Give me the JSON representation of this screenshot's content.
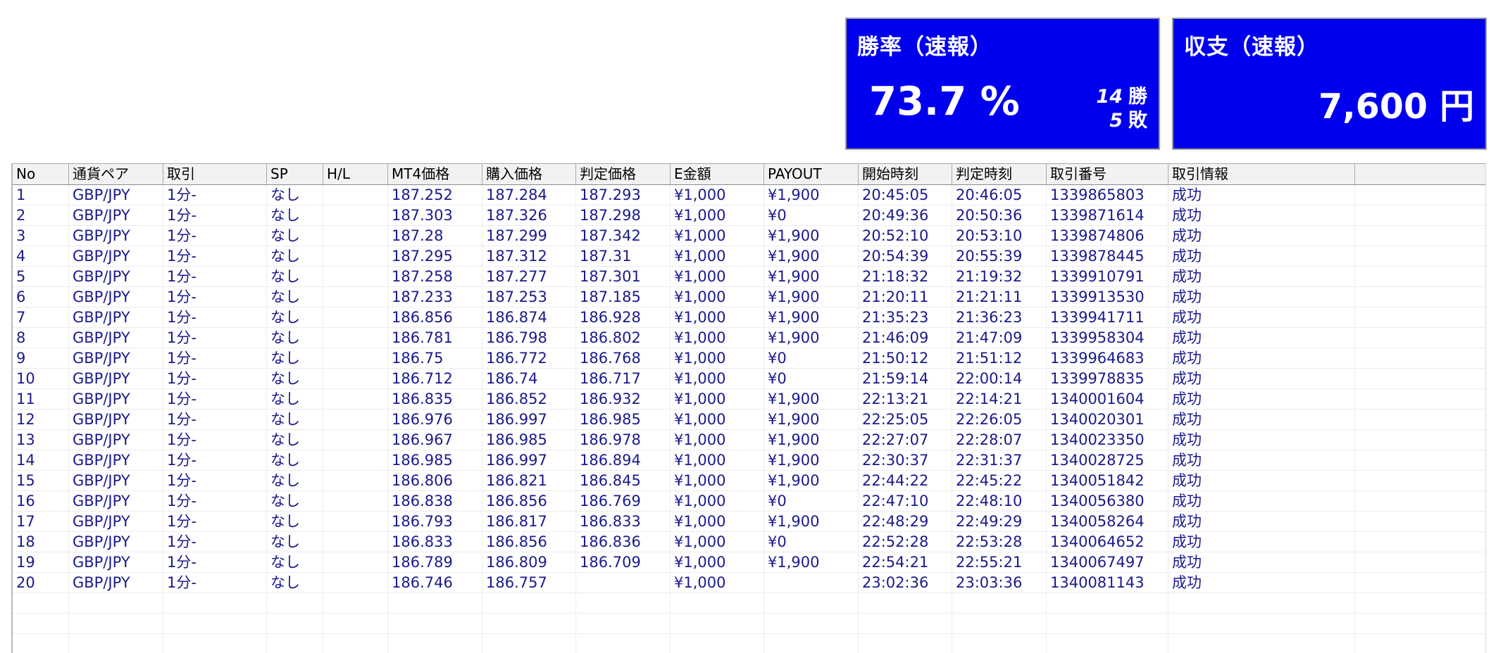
{
  "winrate_panel": {
    "title": "勝率（速報）",
    "value": "73.7 %",
    "wins": "14",
    "wins_unit": "勝",
    "losses": "5",
    "losses_unit": "敗"
  },
  "balance_panel": {
    "title": "収支（速報）",
    "value": "7,600 円"
  },
  "colors": {
    "panel_bg": "#0000ee",
    "panel_text": "#ffffff",
    "table_text": "#1a1a8c"
  },
  "table": {
    "columns": [
      "No",
      "通貨ペア",
      "取引",
      "SP",
      "H/L",
      "MT4価格",
      "購入価格",
      "判定価格",
      "E金額",
      "PAYOUT",
      "開始時刻",
      "判定時刻",
      "取引番号",
      "取引情報",
      ""
    ],
    "rows": [
      [
        "1",
        "GBP/JPY",
        "1分-",
        "なし",
        "",
        "187.252",
        "187.284",
        "187.293",
        "¥1,000",
        "¥1,900",
        "20:45:05",
        "20:46:05",
        "1339865803",
        "成功",
        ""
      ],
      [
        "2",
        "GBP/JPY",
        "1分-",
        "なし",
        "",
        "187.303",
        "187.326",
        "187.298",
        "¥1,000",
        "¥0",
        "20:49:36",
        "20:50:36",
        "1339871614",
        "成功",
        ""
      ],
      [
        "3",
        "GBP/JPY",
        "1分-",
        "なし",
        "",
        "187.28",
        "187.299",
        "187.342",
        "¥1,000",
        "¥1,900",
        "20:52:10",
        "20:53:10",
        "1339874806",
        "成功",
        ""
      ],
      [
        "4",
        "GBP/JPY",
        "1分-",
        "なし",
        "",
        "187.295",
        "187.312",
        "187.31",
        "¥1,000",
        "¥1,900",
        "20:54:39",
        "20:55:39",
        "1339878445",
        "成功",
        ""
      ],
      [
        "5",
        "GBP/JPY",
        "1分-",
        "なし",
        "",
        "187.258",
        "187.277",
        "187.301",
        "¥1,000",
        "¥1,900",
        "21:18:32",
        "21:19:32",
        "1339910791",
        "成功",
        ""
      ],
      [
        "6",
        "GBP/JPY",
        "1分-",
        "なし",
        "",
        "187.233",
        "187.253",
        "187.185",
        "¥1,000",
        "¥1,900",
        "21:20:11",
        "21:21:11",
        "1339913530",
        "成功",
        ""
      ],
      [
        "7",
        "GBP/JPY",
        "1分-",
        "なし",
        "",
        "186.856",
        "186.874",
        "186.928",
        "¥1,000",
        "¥1,900",
        "21:35:23",
        "21:36:23",
        "1339941711",
        "成功",
        ""
      ],
      [
        "8",
        "GBP/JPY",
        "1分-",
        "なし",
        "",
        "186.781",
        "186.798",
        "186.802",
        "¥1,000",
        "¥1,900",
        "21:46:09",
        "21:47:09",
        "1339958304",
        "成功",
        ""
      ],
      [
        "9",
        "GBP/JPY",
        "1分-",
        "なし",
        "",
        "186.75",
        "186.772",
        "186.768",
        "¥1,000",
        "¥0",
        "21:50:12",
        "21:51:12",
        "1339964683",
        "成功",
        ""
      ],
      [
        "10",
        "GBP/JPY",
        "1分-",
        "なし",
        "",
        "186.712",
        "186.74",
        "186.717",
        "¥1,000",
        "¥0",
        "21:59:14",
        "22:00:14",
        "1339978835",
        "成功",
        ""
      ],
      [
        "11",
        "GBP/JPY",
        "1分-",
        "なし",
        "",
        "186.835",
        "186.852",
        "186.932",
        "¥1,000",
        "¥1,900",
        "22:13:21",
        "22:14:21",
        "1340001604",
        "成功",
        ""
      ],
      [
        "12",
        "GBP/JPY",
        "1分-",
        "なし",
        "",
        "186.976",
        "186.997",
        "186.985",
        "¥1,000",
        "¥1,900",
        "22:25:05",
        "22:26:05",
        "1340020301",
        "成功",
        ""
      ],
      [
        "13",
        "GBP/JPY",
        "1分-",
        "なし",
        "",
        "186.967",
        "186.985",
        "186.978",
        "¥1,000",
        "¥1,900",
        "22:27:07",
        "22:28:07",
        "1340023350",
        "成功",
        ""
      ],
      [
        "14",
        "GBP/JPY",
        "1分-",
        "なし",
        "",
        "186.985",
        "186.997",
        "186.894",
        "¥1,000",
        "¥1,900",
        "22:30:37",
        "22:31:37",
        "1340028725",
        "成功",
        ""
      ],
      [
        "15",
        "GBP/JPY",
        "1分-",
        "なし",
        "",
        "186.806",
        "186.821",
        "186.845",
        "¥1,000",
        "¥1,900",
        "22:44:22",
        "22:45:22",
        "1340051842",
        "成功",
        ""
      ],
      [
        "16",
        "GBP/JPY",
        "1分-",
        "なし",
        "",
        "186.838",
        "186.856",
        "186.769",
        "¥1,000",
        "¥0",
        "22:47:10",
        "22:48:10",
        "1340056380",
        "成功",
        ""
      ],
      [
        "17",
        "GBP/JPY",
        "1分-",
        "なし",
        "",
        "186.793",
        "186.817",
        "186.833",
        "¥1,000",
        "¥1,900",
        "22:48:29",
        "22:49:29",
        "1340058264",
        "成功",
        ""
      ],
      [
        "18",
        "GBP/JPY",
        "1分-",
        "なし",
        "",
        "186.833",
        "186.856",
        "186.836",
        "¥1,000",
        "¥0",
        "22:52:28",
        "22:53:28",
        "1340064652",
        "成功",
        ""
      ],
      [
        "19",
        "GBP/JPY",
        "1分-",
        "なし",
        "",
        "186.789",
        "186.809",
        "186.709",
        "¥1,000",
        "¥1,900",
        "22:54:21",
        "22:55:21",
        "1340067497",
        "成功",
        ""
      ],
      [
        "20",
        "GBP/JPY",
        "1分-",
        "なし",
        "",
        "186.746",
        "186.757",
        "",
        "¥1,000",
        "",
        "23:02:36",
        "23:03:36",
        "1340081143",
        "成功",
        ""
      ]
    ]
  }
}
